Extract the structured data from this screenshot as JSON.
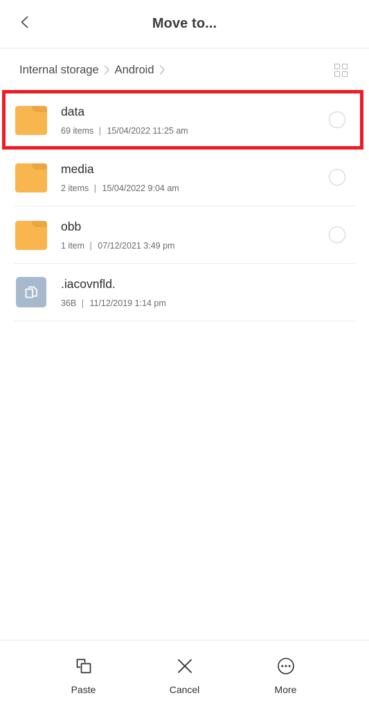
{
  "header": {
    "back_icon": "chevron-left-icon",
    "title": "Move to..."
  },
  "breadcrumb": {
    "items": [
      {
        "label": "Internal storage"
      },
      {
        "label": "Android"
      }
    ],
    "separator": "›",
    "view_toggle_icon": "grid-view-icon"
  },
  "file_list": {
    "rows": [
      {
        "name": "data",
        "meta_count": "69 items",
        "meta_sep": "|",
        "meta_date": "15/04/2022 11:25 am",
        "icon": "folder-icon",
        "selectable": true,
        "highlighted": true
      },
      {
        "name": "media",
        "meta_count": "2 items",
        "meta_sep": "|",
        "meta_date": "15/04/2022 9:04 am",
        "icon": "folder-icon",
        "selectable": true,
        "highlighted": false
      },
      {
        "name": "obb",
        "meta_count": "1 item",
        "meta_sep": "|",
        "meta_date": "07/12/2021 3:49 pm",
        "icon": "folder-icon",
        "selectable": true,
        "highlighted": false
      },
      {
        "name": ".iacovnfld.",
        "meta_count": "36B",
        "meta_sep": "|",
        "meta_date": "11/12/2019 1:14 pm",
        "icon": "file-copy-icon",
        "selectable": false,
        "highlighted": false
      }
    ]
  },
  "toolbar": {
    "buttons": [
      {
        "label": "Paste",
        "icon": "paste-icon"
      },
      {
        "label": "Cancel",
        "icon": "close-x-icon"
      },
      {
        "label": "More",
        "icon": "more-ellipsis-icon"
      }
    ]
  },
  "colors": {
    "folder": "#f9b64e",
    "folder_tab": "#eda63f",
    "file_tile": "#a7bacd",
    "highlight": "#ee1c25",
    "divider": "#ededed",
    "text_primary": "#2d2d2d",
    "text_secondary": "#6b6b6b"
  }
}
